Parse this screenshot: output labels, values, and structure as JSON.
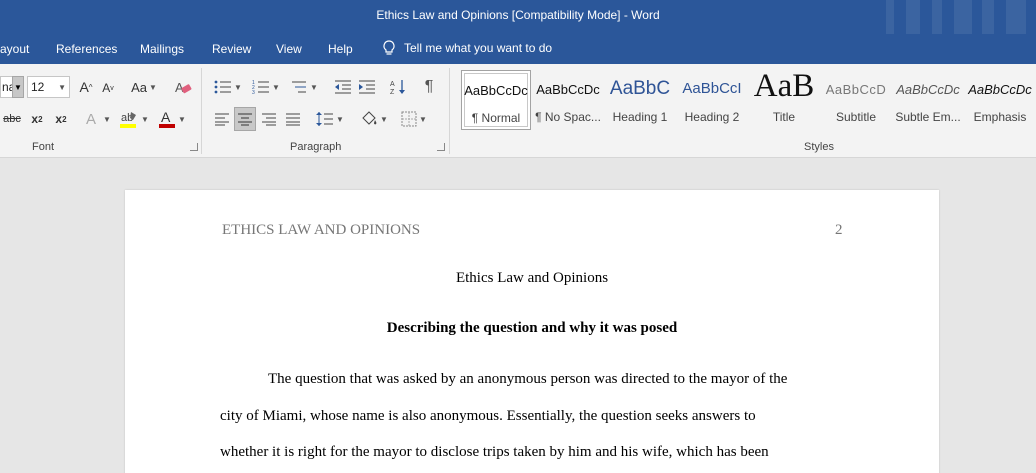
{
  "window": {
    "title": "Ethics Law and Opinions [Compatibility Mode]  -  Word"
  },
  "menu": {
    "items": [
      "ayout",
      "References",
      "Mailings",
      "Review",
      "View",
      "Help"
    ],
    "tell_me": "Tell me what you want to do"
  },
  "ribbon": {
    "font": {
      "label": "Font",
      "name_value": "na",
      "size_value": "12",
      "grow_label": "A",
      "shrink_label": "A",
      "case_label": "Aa",
      "strike_label": "abc",
      "subscript_label": "x",
      "superscript_label": "x",
      "effects_label": "A",
      "color_label": "A"
    },
    "paragraph": {
      "label": "Paragraph"
    },
    "styles": {
      "label": "Styles",
      "items": [
        {
          "preview": "AaBbCcDc",
          "label": "¶ Normal"
        },
        {
          "preview": "AaBbCcDc",
          "label": "¶ No Spac..."
        },
        {
          "preview": "AaBbC",
          "label": "Heading 1"
        },
        {
          "preview": "AaBbCcI",
          "label": "Heading 2"
        },
        {
          "preview": "AaB",
          "label": "Title"
        },
        {
          "preview": "AaBbCcD",
          "label": "Subtitle"
        },
        {
          "preview": "AaBbCcDc",
          "label": "Subtle Em..."
        },
        {
          "preview": "AaBbCcDc",
          "label": "Emphasis"
        }
      ]
    }
  },
  "document": {
    "running_head": "ETHICS LAW AND OPINIONS",
    "page_number": "2",
    "title": "Ethics Law and Opinions",
    "heading": "Describing the question and why it was posed",
    "paragraph_lines": [
      "The question that was asked by an anonymous person was directed to the mayor of the",
      "city of Miami, whose name is also anonymous. Essentially, the question seeks answers to",
      "whether it is right for the mayor to disclose trips taken by him and his wife, which has been"
    ]
  },
  "colors": {
    "brand": "#2b579a",
    "ribbon": "#f3f3f3",
    "canvas": "#e6e6e6"
  }
}
